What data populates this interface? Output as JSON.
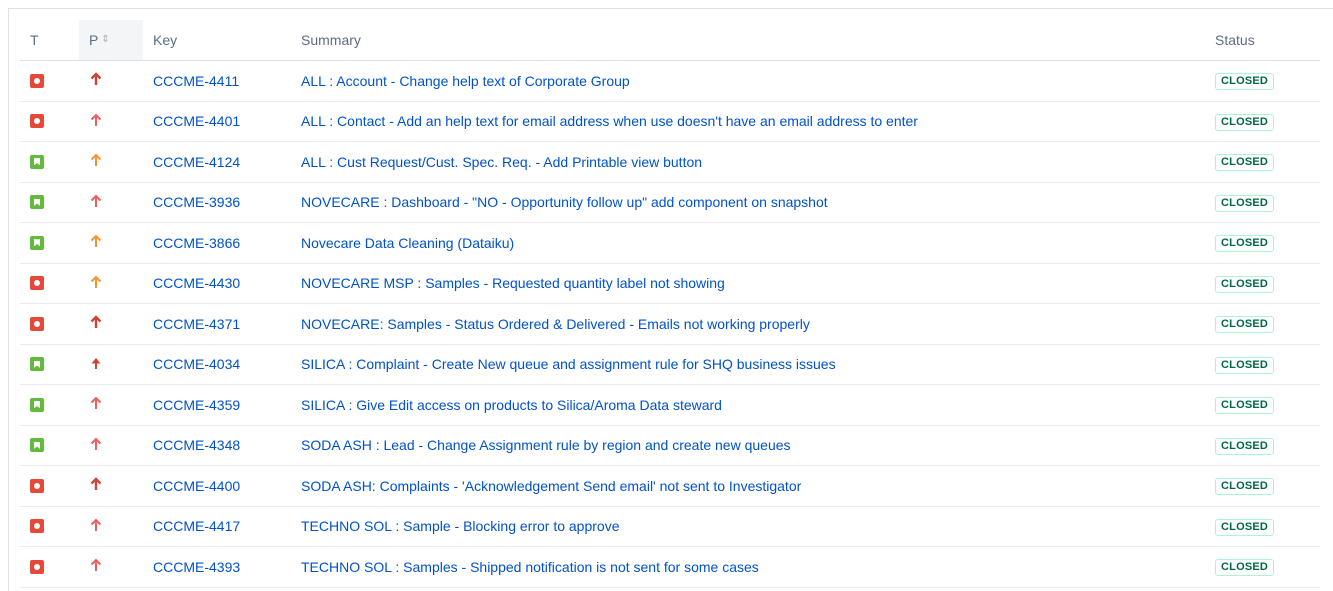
{
  "headers": {
    "type": "T",
    "priority": "P",
    "key": "Key",
    "summary": "Summary",
    "status": "Status"
  },
  "icons": {
    "sort": "sort-icon",
    "bug": "bug-icon",
    "story": "story-icon",
    "priority_high": "priority-high-arrow-icon"
  },
  "colors": {
    "bug": "#e5493a",
    "story": "#63ba3c",
    "priority_highest": "#d04437",
    "priority_high": "#f15c5c",
    "priority_medium": "#f79232",
    "link": "#0052cc",
    "status_done": "#006644"
  },
  "rows": [
    {
      "type": "bug",
      "priority": "highest",
      "key": "CCCME-4411",
      "summary": "ALL : Account - Change help text of Corporate Group",
      "status": "CLOSED"
    },
    {
      "type": "bug",
      "priority": "high",
      "key": "CCCME-4401",
      "summary": "ALL : Contact - Add an help text for email address when use doesn't have an email address to enter",
      "status": "CLOSED"
    },
    {
      "type": "story",
      "priority": "medium",
      "key": "CCCME-4124",
      "summary": "ALL : Cust Request/Cust. Spec. Req. - Add Printable view button",
      "status": "CLOSED"
    },
    {
      "type": "story",
      "priority": "high",
      "key": "CCCME-3936",
      "summary": "NOVECARE : Dashboard - \"NO - Opportunity follow up\" add component on snapshot",
      "status": "CLOSED"
    },
    {
      "type": "story",
      "priority": "medium",
      "key": "CCCME-3866",
      "summary": "Novecare Data Cleaning (Dataiku)",
      "status": "CLOSED"
    },
    {
      "type": "bug",
      "priority": "medium",
      "key": "CCCME-4430",
      "summary": "NOVECARE MSP : Samples - Requested quantity label not showing",
      "status": "CLOSED"
    },
    {
      "type": "bug",
      "priority": "highest",
      "key": "CCCME-4371",
      "summary": "NOVECARE: Samples - Status Ordered & Delivered - Emails not working properly",
      "status": "CLOSED"
    },
    {
      "type": "story",
      "priority": "blocker",
      "key": "CCCME-4034",
      "summary": "SILICA : Complaint - Create New queue and assignment rule for SHQ business issues",
      "status": "CLOSED"
    },
    {
      "type": "story",
      "priority": "high",
      "key": "CCCME-4359",
      "summary": "SILICA : Give Edit access on products to Silica/Aroma Data steward",
      "status": "CLOSED"
    },
    {
      "type": "story",
      "priority": "high",
      "key": "CCCME-4348",
      "summary": "SODA ASH : Lead - Change Assignment rule by region and create new queues",
      "status": "CLOSED"
    },
    {
      "type": "bug",
      "priority": "highest",
      "key": "CCCME-4400",
      "summary": "SODA ASH: Complaints - 'Acknowledgement Send email' not sent to Investigator",
      "status": "CLOSED"
    },
    {
      "type": "bug",
      "priority": "high",
      "key": "CCCME-4417",
      "summary": "TECHNO SOL : Sample - Blocking error to approve",
      "status": "CLOSED"
    },
    {
      "type": "bug",
      "priority": "high",
      "key": "CCCME-4393",
      "summary": "TECHNO SOL : Samples - Shipped notification is not sent for some cases",
      "status": "CLOSED"
    }
  ]
}
